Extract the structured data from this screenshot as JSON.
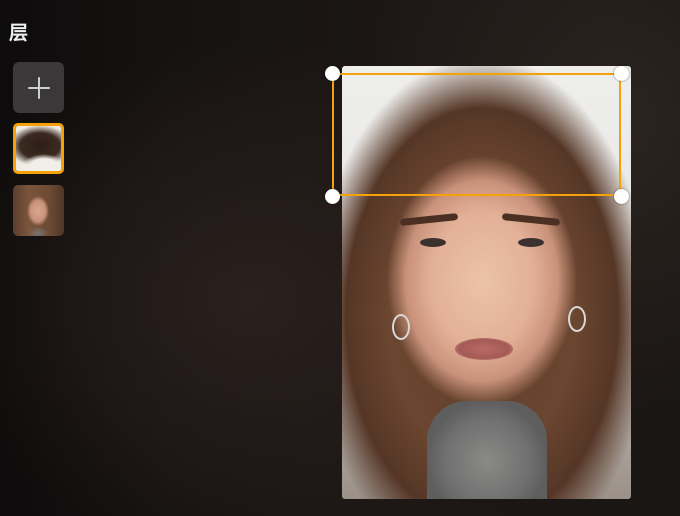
{
  "layers_panel": {
    "title": "层",
    "add_button_icon": "plus-icon",
    "layers": [
      {
        "name": "hair-layer",
        "selected": true
      },
      {
        "name": "face-photo-layer",
        "selected": false
      }
    ]
  },
  "canvas": {
    "selection_color": "#f5a10a",
    "handle_icon": "circle-handle"
  }
}
